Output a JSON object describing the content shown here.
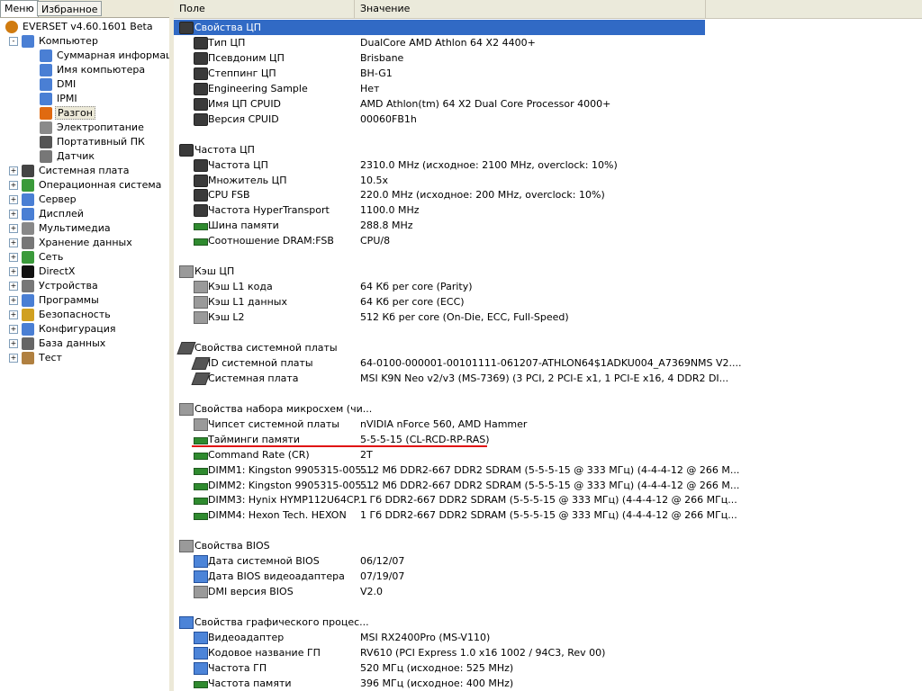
{
  "left_tabs": [
    "Меню",
    "Избранное"
  ],
  "tree": [
    {
      "label": "EVERSET v4.60.1601 Beta",
      "level": 0,
      "exp": "",
      "icon": "everest-info-icon",
      "color": "#d07b10"
    },
    {
      "label": "Компьютер",
      "level": 1,
      "exp": "-",
      "icon": "computer-icon",
      "color": "#4a7fd4"
    },
    {
      "label": "Суммарная информация",
      "level": 2,
      "exp": "",
      "icon": "summary-icon",
      "color": "#4a7fd4"
    },
    {
      "label": "Имя компьютера",
      "level": 2,
      "exp": "",
      "icon": "computer-name-icon",
      "color": "#4a7fd4"
    },
    {
      "label": "DMI",
      "level": 2,
      "exp": "",
      "icon": "dmi-icon",
      "color": "#4a7fd4"
    },
    {
      "label": "IPMI",
      "level": 2,
      "exp": "",
      "icon": "ipmi-icon",
      "color": "#4a7fd4"
    },
    {
      "label": "Разгон",
      "level": 2,
      "exp": "",
      "icon": "overclock-flame-icon",
      "color": "#e06a10",
      "selected": true
    },
    {
      "label": "Электропитание",
      "level": 2,
      "exp": "",
      "icon": "power-icon",
      "color": "#8a8a8a"
    },
    {
      "label": "Портативный ПК",
      "level": 2,
      "exp": "",
      "icon": "laptop-icon",
      "color": "#555555"
    },
    {
      "label": "Датчик",
      "level": 2,
      "exp": "",
      "icon": "sensor-icon",
      "color": "#777777"
    },
    {
      "label": "Системная плата",
      "level": 1,
      "exp": "+",
      "icon": "motherboard-icon",
      "color": "#444444"
    },
    {
      "label": "Операционная система",
      "level": 1,
      "exp": "+",
      "icon": "windows-icon",
      "color": "#3a9a3a"
    },
    {
      "label": "Сервер",
      "level": 1,
      "exp": "+",
      "icon": "server-icon",
      "color": "#4a7fd4"
    },
    {
      "label": "Дисплей",
      "level": 1,
      "exp": "+",
      "icon": "display-icon",
      "color": "#4a7fd4"
    },
    {
      "label": "Мультимедиа",
      "level": 1,
      "exp": "+",
      "icon": "multimedia-icon",
      "color": "#888888"
    },
    {
      "label": "Хранение данных",
      "level": 1,
      "exp": "+",
      "icon": "storage-icon",
      "color": "#777777"
    },
    {
      "label": "Сеть",
      "level": 1,
      "exp": "+",
      "icon": "network-icon",
      "color": "#3a9a3a"
    },
    {
      "label": "DirectX",
      "level": 1,
      "exp": "+",
      "icon": "directx-icon",
      "color": "#111111"
    },
    {
      "label": "Устройства",
      "level": 1,
      "exp": "+",
      "icon": "devices-icon",
      "color": "#777777"
    },
    {
      "label": "Программы",
      "level": 1,
      "exp": "+",
      "icon": "programs-icon",
      "color": "#4a7fd4"
    },
    {
      "label": "Безопасность",
      "level": 1,
      "exp": "+",
      "icon": "security-shield-icon",
      "color": "#d0a020"
    },
    {
      "label": "Конфигурация",
      "level": 1,
      "exp": "+",
      "icon": "config-icon",
      "color": "#4a7fd4"
    },
    {
      "label": "База данных",
      "level": 1,
      "exp": "+",
      "icon": "database-icon",
      "color": "#666666"
    },
    {
      "label": "Тест",
      "level": 1,
      "exp": "+",
      "icon": "hourglass-icon",
      "color": "#b08040"
    }
  ],
  "columns": {
    "field": "Поле",
    "value": "Значение"
  },
  "rows": [
    {
      "type": "section",
      "field": "Свойства ЦП",
      "icon": "cpu-chip-icon",
      "selected": true
    },
    {
      "type": "item",
      "field": "Тип ЦП",
      "value": "DualCore AMD Athlon 64 X2 4400+",
      "icon": "cpu-chip-icon"
    },
    {
      "type": "item",
      "field": "Псевдоним ЦП",
      "value": "Brisbane",
      "icon": "cpu-chip-icon"
    },
    {
      "type": "item",
      "field": "Степпинг ЦП",
      "value": "BH-G1",
      "icon": "cpu-chip-icon"
    },
    {
      "type": "item",
      "field": "Engineering Sample",
      "value": "Нет",
      "icon": "cpu-chip-icon"
    },
    {
      "type": "item",
      "field": "Имя ЦП CPUID",
      "value": "AMD Athlon(tm) 64 X2 Dual Core Processor 4000+",
      "icon": "cpu-chip-icon"
    },
    {
      "type": "item",
      "field": "Версия CPUID",
      "value": "00060FB1h",
      "icon": "cpu-chip-icon"
    },
    {
      "type": "blank"
    },
    {
      "type": "section",
      "field": "Частота ЦП",
      "icon": "cpu-chip-icon"
    },
    {
      "type": "item",
      "field": "Частота ЦП",
      "value": "2310.0 MHz  (исходное: 2100 MHz, overclock: 10%)",
      "icon": "cpu-chip-icon"
    },
    {
      "type": "item",
      "field": "Множитель ЦП",
      "value": "10.5x",
      "icon": "cpu-chip-icon"
    },
    {
      "type": "item",
      "field": "CPU FSB",
      "value": "220.0 MHz  (исходное: 200 MHz, overclock: 10%)",
      "icon": "cpu-chip-icon"
    },
    {
      "type": "item",
      "field": "Частота HyperTransport",
      "value": "1100.0 MHz",
      "icon": "cpu-chip-icon"
    },
    {
      "type": "item",
      "field": "Шина памяти",
      "value": "288.8 MHz",
      "icon": "ram-module-icon"
    },
    {
      "type": "item",
      "field": "Соотношение DRAM:FSB",
      "value": "CPU/8",
      "icon": "ram-module-icon"
    },
    {
      "type": "blank"
    },
    {
      "type": "section",
      "field": "Кэш ЦП",
      "icon": "cache-icon"
    },
    {
      "type": "item",
      "field": "Кэш L1 кода",
      "value": "64 Кб per core  (Parity)",
      "icon": "cache-icon"
    },
    {
      "type": "item",
      "field": "Кэш L1 данных",
      "value": "64 Кб per core  (ECC)",
      "icon": "cache-icon"
    },
    {
      "type": "item",
      "field": "Кэш L2",
      "value": "512 Кб per core  (On-Die, ECC, Full-Speed)",
      "icon": "cache-icon"
    },
    {
      "type": "blank"
    },
    {
      "type": "section",
      "field": "Свойства системной платы",
      "icon": "motherboard-icon"
    },
    {
      "type": "item",
      "field": "ID системной платы",
      "value": "64-0100-000001-00101111-061207-ATHLON64$1ADKU004_A7369NMS V2....",
      "icon": "motherboard-icon"
    },
    {
      "type": "item",
      "field": "Системная плата",
      "value": "MSI K9N Neo v2/v3 (MS-7369)  (3 PCI, 2 PCI-E x1, 1 PCI-E x16, 4 DDR2 DI...",
      "icon": "motherboard-icon"
    },
    {
      "type": "blank"
    },
    {
      "type": "section",
      "field": "Свойства набора микросхем (чи...",
      "icon": "chipset-icon"
    },
    {
      "type": "item",
      "field": "Чипсет системной платы",
      "value": "nVIDIA nForce 560, AMD Hammer",
      "icon": "chipset-icon"
    },
    {
      "type": "item",
      "field": "Тайминги памяти",
      "value": "5-5-5-15  (CL-RCD-RP-RAS)",
      "icon": "ram-module-icon"
    },
    {
      "type": "item",
      "field": "Command Rate (CR)",
      "value": "2T",
      "icon": "ram-module-icon"
    },
    {
      "type": "item",
      "field": "DIMM1: Kingston 9905315-005....",
      "value": "512 Мб DDR2-667 DDR2 SDRAM  (5-5-5-15 @ 333 МГц)  (4-4-4-12 @ 266 М...",
      "icon": "ram-module-icon"
    },
    {
      "type": "item",
      "field": "DIMM2: Kingston 9905315-005....",
      "value": "512 Мб DDR2-667 DDR2 SDRAM  (5-5-5-15 @ 333 МГц)  (4-4-4-12 @ 266 М...",
      "icon": "ram-module-icon"
    },
    {
      "type": "item",
      "field": "DIMM3: Hynix HYMP112U64CP...",
      "value": "1 Гб DDR2-667 DDR2 SDRAM  (5-5-5-15 @ 333 МГц)  (4-4-4-12 @ 266 МГц...",
      "icon": "ram-module-icon"
    },
    {
      "type": "item",
      "field": "DIMM4: Hexon Tech. HEXON",
      "value": "1 Гб DDR2-667 DDR2 SDRAM  (5-5-5-15 @ 333 МГц)  (4-4-4-12 @ 266 МГц...",
      "icon": "ram-module-icon"
    },
    {
      "type": "blank"
    },
    {
      "type": "section",
      "field": "Свойства BIOS",
      "icon": "bios-chip-icon"
    },
    {
      "type": "item",
      "field": "Дата системной BIOS",
      "value": "06/12/07",
      "icon": "computer-icon"
    },
    {
      "type": "item",
      "field": "Дата BIOS видеоадаптера",
      "value": "07/19/07",
      "icon": "computer-icon"
    },
    {
      "type": "item",
      "field": "DMI версия BIOS",
      "value": "V2.0",
      "icon": "bios-chip-icon"
    },
    {
      "type": "blank"
    },
    {
      "type": "section",
      "field": "Свойства графического процес...",
      "icon": "monitor-icon"
    },
    {
      "type": "item",
      "field": "Видеоадаптер",
      "value": "MSI RX2400Pro (MS-V110)",
      "icon": "monitor-icon"
    },
    {
      "type": "item",
      "field": "Кодовое название ГП",
      "value": "RV610  (PCI Express 1.0 x16 1002 / 94C3, Rev 00)",
      "icon": "monitor-icon"
    },
    {
      "type": "item",
      "field": "Частота ГП",
      "value": "520 МГц  (исходное: 525 MHz)",
      "icon": "monitor-icon"
    },
    {
      "type": "item",
      "field": "Частота памяти",
      "value": "396 МГц  (исходное: 400 MHz)",
      "icon": "ram-module-icon"
    }
  ]
}
